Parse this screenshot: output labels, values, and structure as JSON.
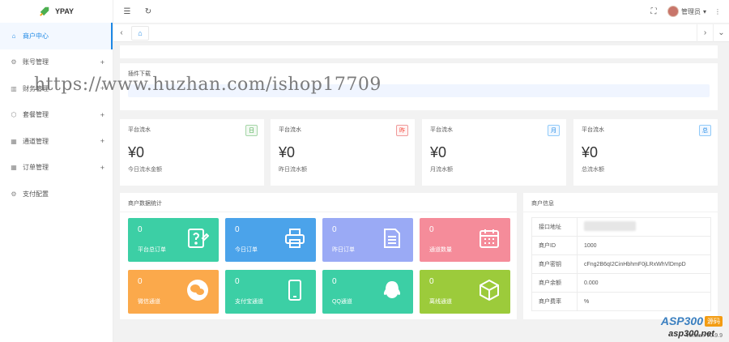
{
  "app": {
    "name": "YPAY"
  },
  "sidebar": {
    "items": [
      {
        "label": "商户中心",
        "icon": "home-icon",
        "active": true,
        "expandable": false
      },
      {
        "label": "账号管理",
        "icon": "gear-icon",
        "active": false,
        "expandable": true
      },
      {
        "label": "财务管理",
        "icon": "chart-icon",
        "active": false,
        "expandable": true
      },
      {
        "label": "套餐管理",
        "icon": "box-icon",
        "active": false,
        "expandable": true
      },
      {
        "label": "通道管理",
        "icon": "grid-icon",
        "active": false,
        "expandable": true
      },
      {
        "label": "订单管理",
        "icon": "grid-icon",
        "active": false,
        "expandable": true
      },
      {
        "label": "支付配置",
        "icon": "gear-icon",
        "active": false,
        "expandable": false
      }
    ],
    "expand_symbol": "+"
  },
  "topbar": {
    "user": "管理员",
    "dropdown_symbol": "▾",
    "more_symbol": "⋮"
  },
  "plugin": {
    "title": "插件下载"
  },
  "stats": [
    {
      "title": "平台流水",
      "badge": "日",
      "value": "¥0",
      "sub": "今日流水金额",
      "color": "#4caf50"
    },
    {
      "title": "平台流水",
      "badge": "昨",
      "value": "¥0",
      "sub": "昨日流水额",
      "color": "#f44336"
    },
    {
      "title": "平台流水",
      "badge": "月",
      "value": "¥0",
      "sub": "月流水额",
      "color": "#1e88e5"
    },
    {
      "title": "平台流水",
      "badge": "总",
      "value": "¥0",
      "sub": "总流水额",
      "color": "#1e88e5"
    }
  ],
  "merchant_stats": {
    "title": "商户数据统计",
    "tiles": [
      {
        "value": "0",
        "label": "平台总订单",
        "icon": "edit-doc-icon",
        "color": "#3ccfa5"
      },
      {
        "value": "0",
        "label": "今日订单",
        "icon": "printer-icon",
        "color": "#4ba3ea"
      },
      {
        "value": "0",
        "label": "昨日订单",
        "icon": "list-icon",
        "color": "#9aaaf5"
      },
      {
        "value": "0",
        "label": "通道数量",
        "icon": "calendar-icon",
        "color": "#f58c9a"
      },
      {
        "value": "0",
        "label": "微信通道",
        "icon": "wechat-icon",
        "color": "#fba94b"
      },
      {
        "value": "0",
        "label": "支付宝通道",
        "icon": "phone-icon",
        "color": "#3ccfa5"
      },
      {
        "value": "0",
        "label": "QQ通道",
        "icon": "qq-icon",
        "color": "#3ccfa5"
      },
      {
        "value": "0",
        "label": "离线通道",
        "icon": "cube-icon",
        "color": "#9ccb3b"
      }
    ]
  },
  "merchant_info": {
    "title": "商户信息",
    "rows": [
      {
        "key": "接口地址",
        "value": ""
      },
      {
        "key": "商户ID",
        "value": "1000"
      },
      {
        "key": "商户密钥",
        "value": "cFng2B6qI2CinHbhmF0jLRxWhVlDmpD"
      },
      {
        "key": "商户余额",
        "value": "0.000"
      },
      {
        "key": "商户费率",
        "value": "%"
      }
    ]
  },
  "watermark": "https://www.huzhan.com/ishop17709",
  "footer": {
    "asp_brand": "ASP300",
    "asp_tag": "源码",
    "asp_url": "asp300.net",
    "version": "Version V0.9.9"
  }
}
